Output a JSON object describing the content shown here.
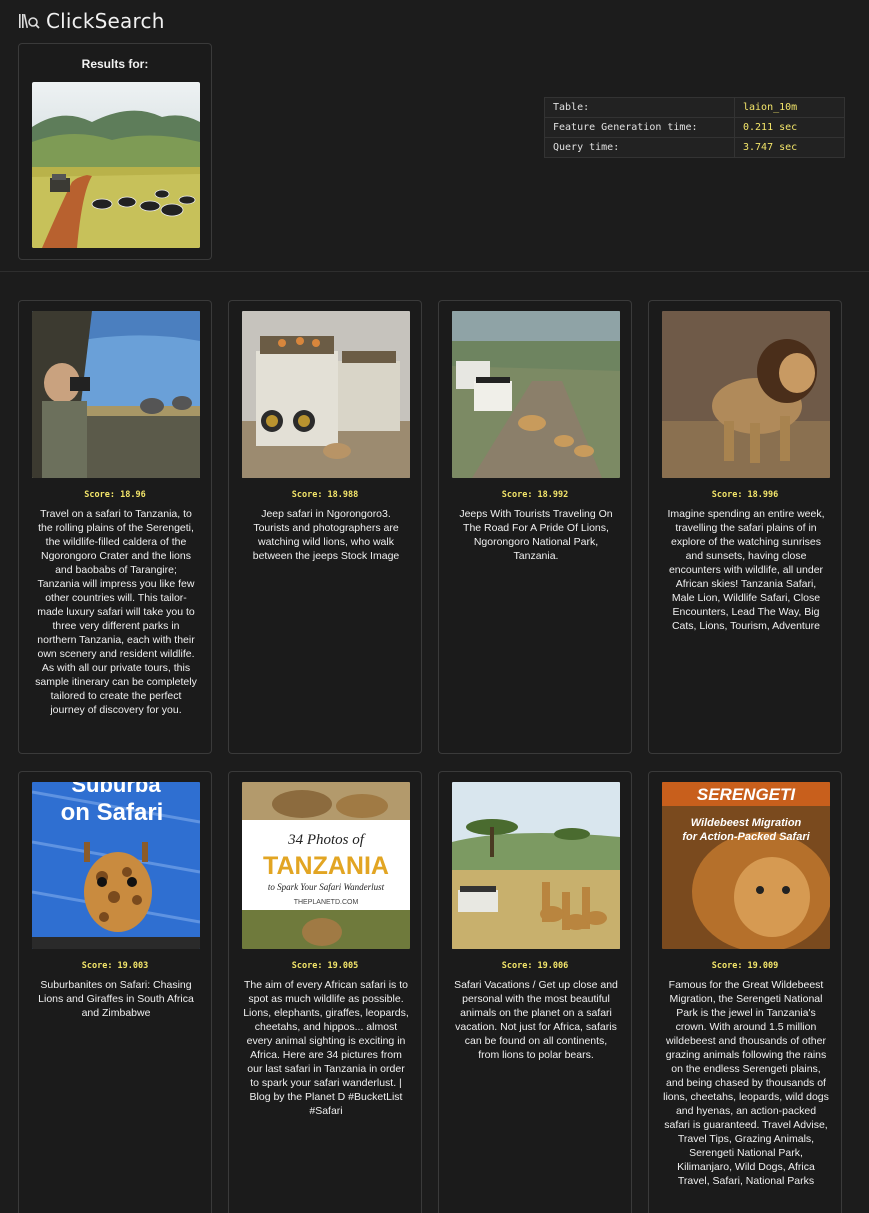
{
  "app": {
    "brand": "ClickSearch",
    "logo_icon": "library-search-icon"
  },
  "query": {
    "title": "Results for:",
    "image_alt": "zebras-and-safari-jeep-on-red-road"
  },
  "stats": [
    {
      "key": "Table:",
      "value": "laion_10m"
    },
    {
      "key": "Feature Generation time:",
      "value": "0.211 sec"
    },
    {
      "key": "Query time:",
      "value": "3.747 sec"
    }
  ],
  "accent_color": "#f3e56a",
  "results": [
    {
      "score": "Score: 18.96",
      "caption": "Travel on a safari to Tanzania, to the rolling plains of the Serengeti, the wildlife-filled caldera of the Ngorongoro Crater and the lions and baobabs of Tarangire; Tanzania will impress you like few other countries will. This tailor-made luxury safari will take you to three very different parks in northern Tanzania, each with their own scenery and resident wildlife. As with all our private tours, this sample itinerary can be completely tailored to create the perfect journey of discovery for you."
    },
    {
      "score": "Score: 18.988",
      "caption": "Jeep safari in Ngorongoro3. Tourists and photographers are watching wild lions, who walk between the jeeps Stock Image"
    },
    {
      "score": "Score: 18.992",
      "caption": "Jeeps With Tourists Traveling On The Road For A Pride Of Lions, Ngorongoro National Park, Tanzania."
    },
    {
      "score": "Score: 18.996",
      "caption": "Imagine spending an entire week, travelling the safari plains of in explore of the watching sunrises and sunsets, having close encounters with wildlife, all under African skies! Tanzania Safari, Male Lion, Wildlife Safari, Close Encounters, Lead The Way, Big Cats, Lions, Tourism, Adventure"
    },
    {
      "score": "Score: 19.003",
      "caption": "Suburbanites on Safari: Chasing Lions and Giraffes in South Africa and Zimbabwe",
      "img_text": "on Safari",
      "img_text_top": "Suburba"
    },
    {
      "score": "Score: 19.005",
      "caption": "The aim of every African safari is to spot as much wildlife as possible. Lions, elephants, giraffes, leopards, cheetahs, and hippos... almost every animal sighting is exciting in Africa. Here are 34 pictures from our last safari in Tanzania in order to spark your safari wanderlust. | Blog by the Planet D #BucketList #Safari",
      "img_line1": "34 Photos of",
      "img_line2": "TANZANIA",
      "img_line3": "to Spark Your Safari Wanderlust",
      "img_line4": "THEPLANETD.COM"
    },
    {
      "score": "Score: 19.006",
      "caption": "Safari Vacations / Get up close and personal with the most beautiful animals on the planet on a safari vacation. Not just for Africa, safaris can be found on all continents, from lions to polar bears."
    },
    {
      "score": "Score: 19.009",
      "caption": "Famous for the Great Wildebeest Migration, the Serengeti National Park is the jewel in Tanzania's crown. With around 1.5 million wildebeest and thousands of other grazing animals following the rains on the endless Serengeti plains, and being chased by thousands of lions, cheetahs, leopards, wild dogs and hyenas, an action-packed safari is guaranteed. Travel Advise, Travel Tips, Grazing Animals, Serengeti National Park, Kilimanjaro, Wild Dogs, Africa Travel, Safari, National Parks",
      "img_line1": "SERENGETI",
      "img_line2": "Wildebeest Migration",
      "img_line3": "for Action-Packed Safari"
    }
  ]
}
